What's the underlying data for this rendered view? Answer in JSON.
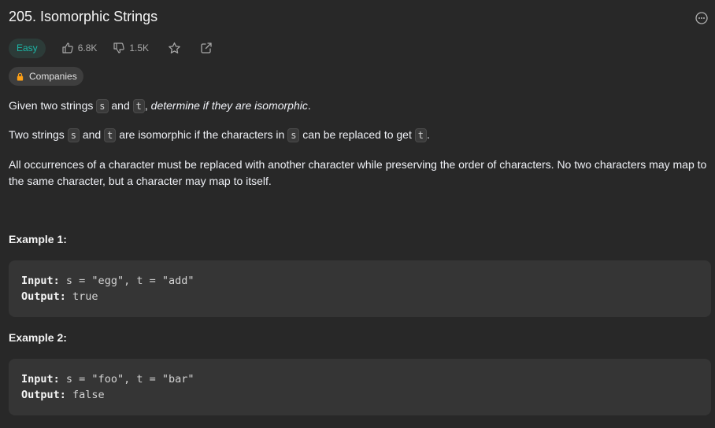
{
  "problem": {
    "title": "205. Isomorphic Strings",
    "difficulty": "Easy",
    "likes": "6.8K",
    "dislikes": "1.5K",
    "companies_label": "Companies"
  },
  "description": {
    "p1": {
      "a": "Given two strings ",
      "code1": "s",
      "b": " and ",
      "code2": "t",
      "c": ", ",
      "italic": "determine if they are isomorphic",
      "d": "."
    },
    "p2": {
      "a": "Two strings ",
      "code1": "s",
      "b": " and ",
      "code2": "t",
      "c": " are isomorphic if the characters in ",
      "code3": "s",
      "d": " can be replaced to get ",
      "code4": "t",
      "e": "."
    },
    "p3": "All occurrences of a character must be replaced with another character while preserving the order of characters. No two characters may map to the same character, but a character may map to itself."
  },
  "examples": [
    {
      "title": "Example 1:",
      "input_label": "Input:",
      "input": "s = \"egg\", t = \"add\"",
      "output_label": "Output:",
      "output": "true"
    },
    {
      "title": "Example 2:",
      "input_label": "Input:",
      "input": "s = \"foo\", t = \"bar\"",
      "output_label": "Output:",
      "output": "false"
    }
  ],
  "colors": {
    "background": "#282828",
    "easy": "#1cb8a8",
    "code_block": "#353535"
  },
  "icons": [
    "more-options-icon",
    "thumbs-up-icon",
    "thumbs-down-icon",
    "star-icon",
    "share-icon",
    "lock-icon"
  ]
}
